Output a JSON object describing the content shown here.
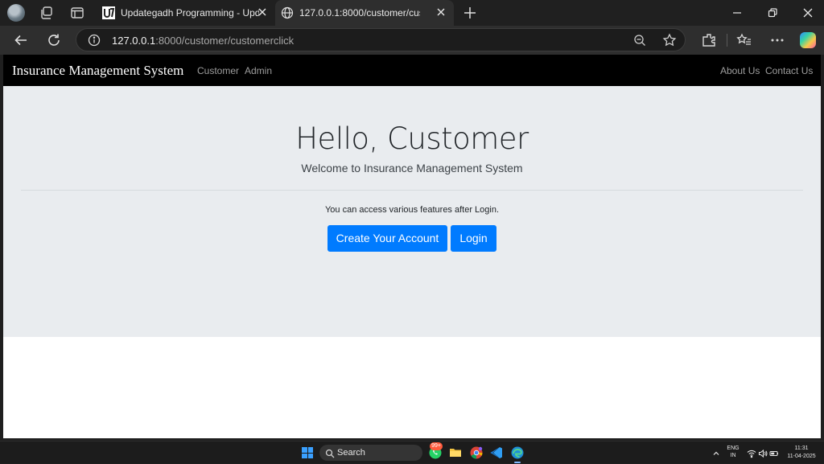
{
  "browser": {
    "tabs": [
      {
        "title": "Updategadh Programming - Upd",
        "active": false
      },
      {
        "title": "127.0.0.1:8000/customer/custome",
        "active": true
      }
    ],
    "url_host": "127.0.0.1",
    "url_path": ":8000/customer/customerclick"
  },
  "navbar": {
    "brand": "Insurance Management System",
    "left_links": [
      "Customer",
      "Admin"
    ],
    "right_links": [
      "About Us",
      "Contact Us"
    ]
  },
  "main": {
    "heading": "Hello, Customer",
    "lead": "Welcome to Insurance Management System",
    "info": "You can access various features after Login.",
    "buttons": {
      "create_account": "Create Your Account",
      "login": "Login"
    }
  },
  "taskbar": {
    "search_label": "Search",
    "notification_badge": "99+",
    "lang_line1": "ENG",
    "lang_line2": "IN",
    "time": "11:31",
    "date": "11-04-2025"
  },
  "colors": {
    "primary_button": "#007bff",
    "navbar_bg": "#000000",
    "jumbotron_bg": "#e9ecef"
  }
}
